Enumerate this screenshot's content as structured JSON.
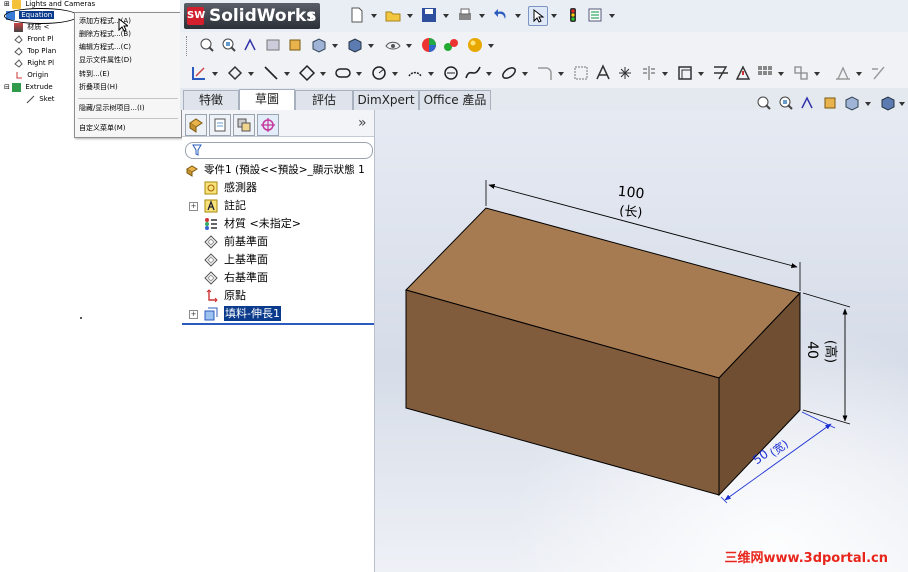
{
  "inset_tree": {
    "rows": [
      {
        "label": "Lights and Cameras"
      },
      {
        "label": "Equation"
      },
      {
        "label": "材质 <"
      },
      {
        "label": "Front Pl"
      },
      {
        "label": "Top Plan"
      },
      {
        "label": "Right Pl"
      },
      {
        "label": "Origin"
      },
      {
        "label": "Extrude"
      },
      {
        "label": "Sket"
      }
    ]
  },
  "context_menu": {
    "items": [
      {
        "label": "添加方程式...(A)"
      },
      {
        "label": "删除方程式...(B)"
      },
      {
        "label": "编辑方程式...(C)"
      },
      {
        "label": "显示文件属性(D)"
      },
      {
        "label": "转到...(E)"
      },
      {
        "label": "折叠项目(H)"
      },
      {
        "label": "隐藏/显示树项目...(I)"
      },
      {
        "label": "自定义菜单(M)"
      }
    ]
  },
  "app": {
    "badge": "SW",
    "name": "SolidWorks"
  },
  "tabs": [
    {
      "label": "特徵"
    },
    {
      "label": "草圖"
    },
    {
      "label": "評估"
    },
    {
      "label": "DimXpert"
    },
    {
      "label": "Office 產品"
    }
  ],
  "feature_tree": {
    "more": "»",
    "items": [
      {
        "label": "零件1  (預設<<預設>_顯示狀態 1"
      },
      {
        "label": "感測器"
      },
      {
        "label": "註記"
      },
      {
        "label": "材質 <未指定>"
      },
      {
        "label": "前基準面"
      },
      {
        "label": "上基準面"
      },
      {
        "label": "右基準面"
      },
      {
        "label": "原點"
      },
      {
        "label": "填料-伸長1"
      }
    ]
  },
  "dimensions": {
    "length": {
      "value": "100",
      "label": "(长)"
    },
    "height": {
      "value": "40",
      "label": "(高)"
    },
    "width": {
      "value": "50",
      "label": "(宽)"
    }
  },
  "watermark": "三维网www.3dportal.cn",
  "colors": {
    "box_front": "#805b3c",
    "box_top": "#a77b51",
    "box_side": "#6f4e31",
    "selection": "#0a3a8c",
    "accent": "#d2202f"
  }
}
